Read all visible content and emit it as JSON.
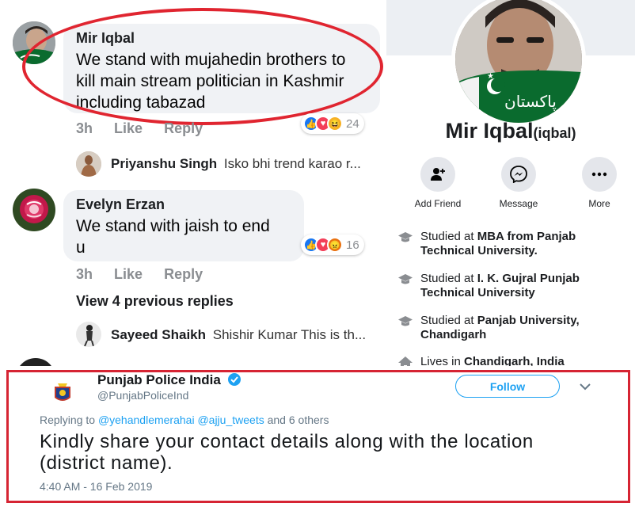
{
  "comments": [
    {
      "name": "Mir Iqbal",
      "text_lines": [
        "We stand with mujahedin brothers to",
        "kill main stream politician in Kashmir",
        "including tabazad"
      ],
      "time": "3h",
      "like": "Like",
      "reply": "Reply",
      "reaction_count": "24"
    },
    {
      "name": "Evelyn Erzan",
      "text_lines": [
        "We stand with jaish  to end",
        "u"
      ],
      "time": "3h",
      "like": "Like",
      "reply": "Reply",
      "reaction_count": "16"
    }
  ],
  "replies": [
    {
      "name": "Priyanshu Singh",
      "text": "Isko bhi trend karao r..."
    },
    {
      "name": "Sayeed Shaikh",
      "text": "Shishir Kumar This is th..."
    }
  ],
  "view_previous": "View 4 previous replies",
  "profile": {
    "name": "Mir Iqbal",
    "username": "(iqbal)",
    "flag_text": "پاکستان",
    "actions": [
      {
        "label": "Add Friend",
        "icon": "add-friend-icon"
      },
      {
        "label": "Message",
        "icon": "messenger-icon"
      },
      {
        "label": "More",
        "icon": "more-dots-icon"
      }
    ],
    "info": [
      {
        "prefix": "Studied at ",
        "bold": "MBA from Panjab Technical University.",
        "icon": "graduation-cap-icon"
      },
      {
        "prefix": "Studied at ",
        "bold": "I. K. Gujral Punjab Technical University",
        "icon": "graduation-cap-icon"
      },
      {
        "prefix": "Studied at ",
        "bold": "Panjab University, Chandigarh",
        "icon": "graduation-cap-icon"
      },
      {
        "prefix": "Lives in ",
        "bold": "Chandigarh, India",
        "icon": "home-icon"
      }
    ]
  },
  "tweet": {
    "name": "Punjab Police India",
    "handle": "@PunjabPoliceInd",
    "follow": "Follow",
    "replying_prefix": "Replying to",
    "replying_user1": "@yehandlemerahai",
    "replying_user2": "@ajju_tweets",
    "replying_suffix": "and 6 others",
    "text": "Kindly share your contact details along with the location (district name).",
    "time": "4:40 AM - 16 Feb 2019"
  },
  "colors": {
    "highlight": "#e02530",
    "facebook_blue": "#1877f2",
    "twitter_blue": "#1da1f2",
    "frame_red": "#d62433"
  }
}
